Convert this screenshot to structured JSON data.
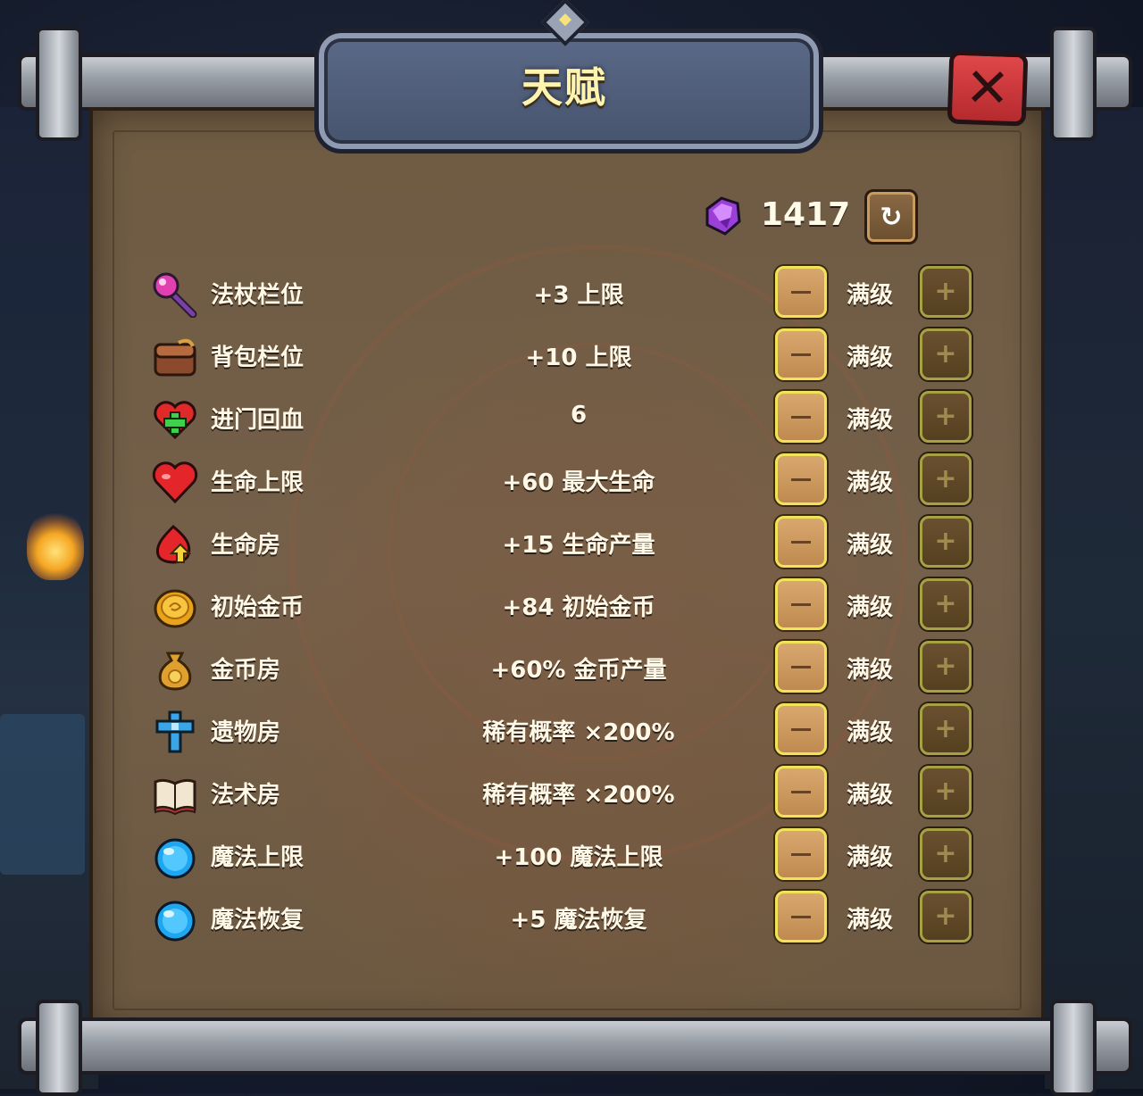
{
  "title": "天赋",
  "close_label": "✕",
  "currency": {
    "icon": "purple-gem-icon",
    "amount": "1417",
    "refresh_glyph": "↻"
  },
  "buttons": {
    "minus_glyph": "−",
    "plus_glyph": "+"
  },
  "talents": [
    {
      "icon": "magic-wand-icon",
      "name": "法杖栏位",
      "value": "+3 上限",
      "level": "满级"
    },
    {
      "icon": "backpack-icon",
      "name": "背包栏位",
      "value": "+10 上限",
      "level": "满级"
    },
    {
      "icon": "heart-plus-icon",
      "name": "进门回血",
      "value": "6",
      "level": "满级"
    },
    {
      "icon": "heart-icon",
      "name": "生命上限",
      "value": "+60 最大生命",
      "level": "满级"
    },
    {
      "icon": "heart-arrow-icon",
      "name": "生命房",
      "value": "+15 生命产量",
      "level": "满级"
    },
    {
      "icon": "gold-coin-icon",
      "name": "初始金币",
      "value": "+84 初始金币",
      "level": "满级"
    },
    {
      "icon": "money-bag-icon",
      "name": "金币房",
      "value": "+60% 金币产量",
      "level": "满级"
    },
    {
      "icon": "blue-cross-icon",
      "name": "遗物房",
      "value": "稀有概率 ×200%",
      "level": "满级"
    },
    {
      "icon": "spell-book-icon",
      "name": "法术房",
      "value": "稀有概率 ×200%",
      "level": "满级"
    },
    {
      "icon": "mana-orb-icon",
      "name": "魔法上限",
      "value": "+100 魔法上限",
      "level": "满级"
    },
    {
      "icon": "mana-orb-icon",
      "name": "魔法恢复",
      "value": "+5 魔法恢复",
      "level": "满级"
    }
  ]
}
